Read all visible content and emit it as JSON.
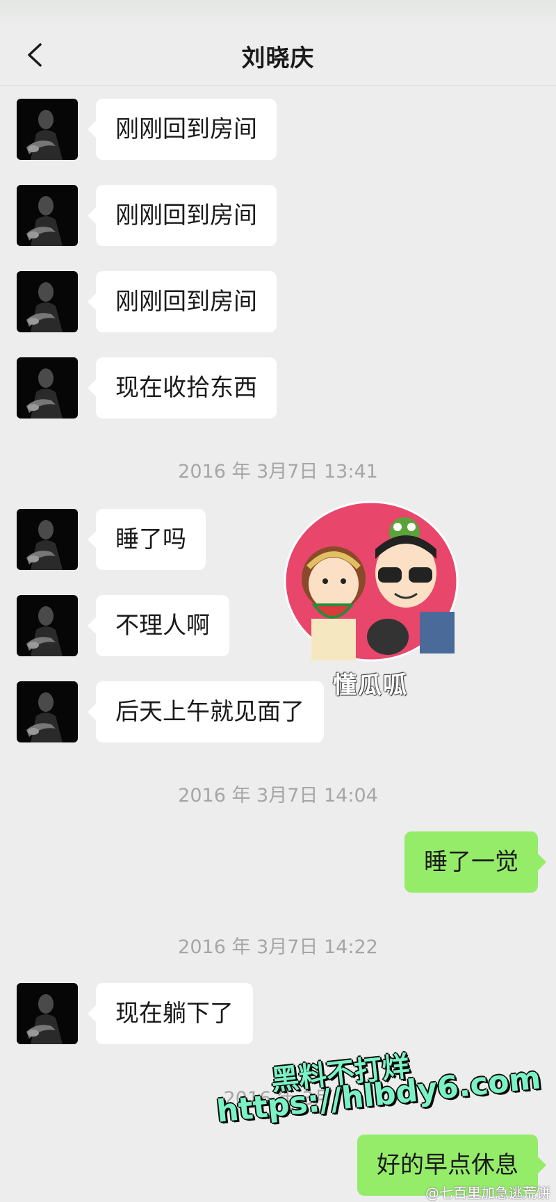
{
  "header": {
    "title": "刘晓庆",
    "back_icon": "chevron-left-icon"
  },
  "messages": [
    {
      "side": "in",
      "text": "刚刚回到房间"
    },
    {
      "side": "in",
      "text": "刚刚回到房间"
    },
    {
      "side": "in",
      "text": "刚刚回到房间"
    },
    {
      "side": "in",
      "text": "现在收拾东西"
    },
    {
      "type": "timestamp",
      "text": "2016 年 3月7日 13:41"
    },
    {
      "side": "in",
      "text": "睡了吗"
    },
    {
      "side": "in",
      "text": "不理人啊"
    },
    {
      "side": "in",
      "text": "后天上午就见面了"
    },
    {
      "type": "timestamp",
      "text": "2016 年 3月7日 14:04"
    },
    {
      "side": "out",
      "text": "睡了一觉"
    },
    {
      "type": "timestamp",
      "text": "2016 年 3月7日 14:22"
    },
    {
      "side": "in",
      "text": "现在躺下了"
    },
    {
      "type": "timestamp",
      "text": "2016 年 3月"
    },
    {
      "side": "out",
      "text": "好的早点休息"
    }
  ],
  "overlay": {
    "logo_text": "懂瓜呱",
    "watermark_line1": "黑料不打烊",
    "watermark_line2": "https://hlbdy6.com",
    "credit": "@七百里加急逃荒饼"
  },
  "colors": {
    "background": "#ededed",
    "incoming_bubble": "#ffffff",
    "outgoing_bubble": "#95ec69",
    "watermark": "#7bf2c5"
  }
}
